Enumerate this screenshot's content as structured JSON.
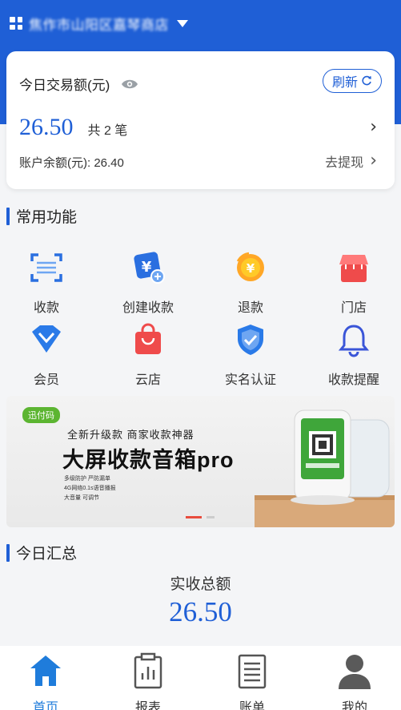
{
  "header": {
    "store_name": "焦作市山阳区嘉琴商店",
    "colors": {
      "brand": "#1f5fd6",
      "accent_text": "#1f5fd6"
    }
  },
  "today_card": {
    "title": "今日交易额(元)",
    "refresh_label": "刷新",
    "amount": "26.50",
    "count_text": "共 2 笔",
    "balance_text": "账户余额(元): 26.40",
    "withdraw_label": "去提现"
  },
  "common_functions": {
    "title": "常用功能",
    "items": [
      {
        "label": "收款",
        "icon": "scan-icon"
      },
      {
        "label": "创建收款",
        "icon": "create-payment-icon"
      },
      {
        "label": "退款",
        "icon": "refund-coin-icon"
      },
      {
        "label": "门店",
        "icon": "store-icon"
      },
      {
        "label": "会员",
        "icon": "diamond-icon"
      },
      {
        "label": "云店",
        "icon": "shopping-bag-icon"
      },
      {
        "label": "实名认证",
        "icon": "shield-check-icon"
      },
      {
        "label": "收款提醒",
        "icon": "bell-icon"
      }
    ]
  },
  "banner": {
    "logo": "迅付码",
    "subtitle": "全新升级款  商家收款神器",
    "headline": "大屏收款音箱pro",
    "features": [
      "多级防护 严防漏单",
      "4G网络0.1s语音播报",
      "大音量 可调节"
    ]
  },
  "summary": {
    "title": "今日汇总",
    "label": "实收总额",
    "amount": "26.50"
  },
  "tabbar": {
    "items": [
      {
        "label": "首页",
        "icon": "home-icon",
        "active": true
      },
      {
        "label": "报表",
        "icon": "report-icon",
        "active": false
      },
      {
        "label": "账单",
        "icon": "bill-icon",
        "active": false
      },
      {
        "label": "我的",
        "icon": "profile-icon",
        "active": false
      }
    ]
  }
}
